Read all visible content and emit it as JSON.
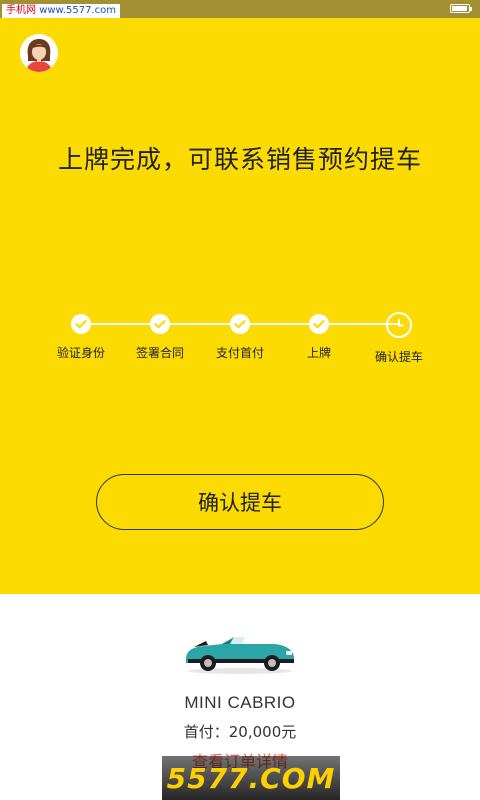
{
  "status_bar": {
    "watermark_site_cn": "手机网",
    "watermark_site_url": "www.5577.com",
    "battery_icon": "battery-icon"
  },
  "header": {
    "avatar_icon": "female-advisor-avatar-icon"
  },
  "main": {
    "headline": "上牌完成，可联系销售预约提车",
    "steps": [
      {
        "label": "验证身份",
        "status": "done",
        "icon": "check-icon"
      },
      {
        "label": "签署合同",
        "status": "done",
        "icon": "check-icon"
      },
      {
        "label": "支付首付",
        "status": "done",
        "icon": "check-icon"
      },
      {
        "label": "上牌",
        "status": "done",
        "icon": "check-icon"
      },
      {
        "label": "确认提车",
        "status": "current",
        "icon": "clock-icon"
      }
    ],
    "confirm_button": "确认提车"
  },
  "order": {
    "car_image_icon": "mini-cabrio-car-icon",
    "car_name": "MINI CABRIO",
    "down_payment": "首付：20,000元",
    "details_link": "查看订单详情"
  },
  "watermark_bottom": "5577.COM",
  "colors": {
    "hero_bg": "#fcdb03",
    "link": "#f0604a",
    "car_body": "#2aa6a8"
  }
}
